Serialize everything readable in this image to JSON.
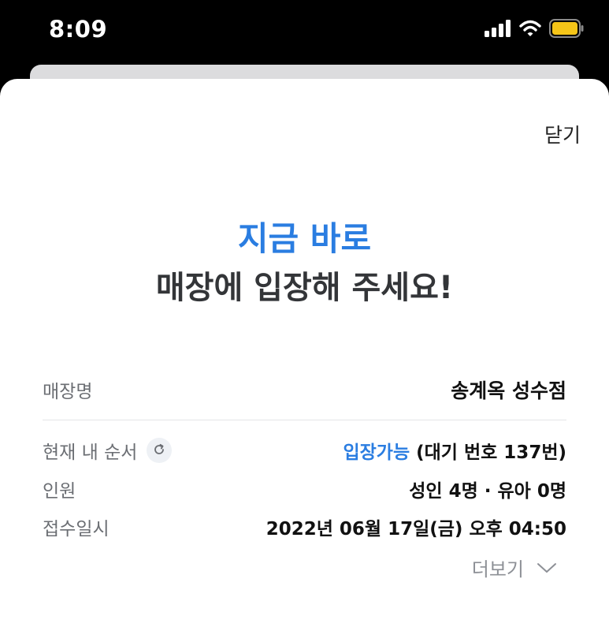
{
  "status_bar": {
    "time": "8:09",
    "icons": [
      "signal-icon",
      "wifi-icon",
      "battery-icon"
    ],
    "battery_color": "#f5c518"
  },
  "sheet": {
    "close_label": "닫기",
    "headline_accent": "지금 바로",
    "headline_main": "매장에 입장해 주세요!",
    "store": {
      "label": "매장명",
      "value": "송계옥 성수점"
    },
    "queue": {
      "label": "현재 내 순서",
      "refresh_icon": "refresh-icon",
      "status": "입장가능",
      "detail": "(대기 번호 137번)"
    },
    "party": {
      "label": "인원",
      "value": "성인 4명 · 유아 0명"
    },
    "received": {
      "label": "접수일시",
      "value": "2022년 06월 17일(금) 오후 04:50"
    },
    "more_label": "더보기",
    "more_icon": "chevron-down-icon"
  },
  "colors": {
    "accent": "#2a7de1",
    "text_dark": "#333538",
    "label_gray": "#6b6e73"
  }
}
